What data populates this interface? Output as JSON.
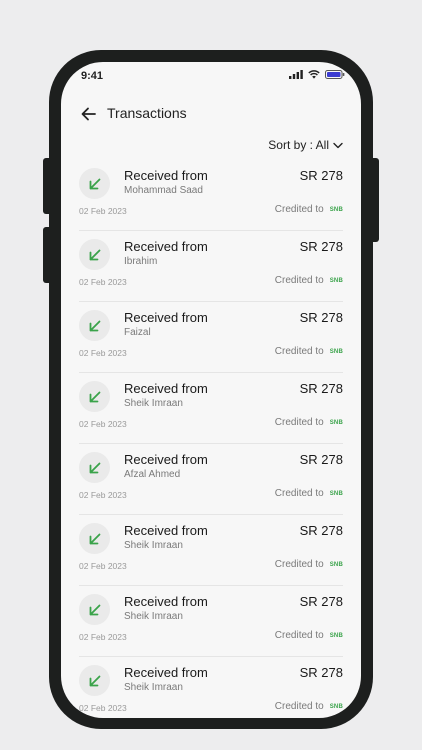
{
  "status": {
    "time": "9:41"
  },
  "header": {
    "title": "Transactions"
  },
  "sort": {
    "label": "Sort by : All"
  },
  "colors": {
    "accent_green": "#3aa34a",
    "icon_bg": "#eaeaea"
  },
  "transactions": [
    {
      "title": "Received from",
      "name": "Mohammad Saad",
      "amount": "SR 278",
      "date": "02 Feb 2023",
      "credited": "Credited to",
      "bank": "SNB"
    },
    {
      "title": "Received from",
      "name": "Ibrahim",
      "amount": "SR 278",
      "date": "02 Feb 2023",
      "credited": "Credited to",
      "bank": "SNB"
    },
    {
      "title": "Received from",
      "name": "Faizal",
      "amount": "SR 278",
      "date": "02 Feb 2023",
      "credited": "Credited to",
      "bank": "SNB"
    },
    {
      "title": "Received from",
      "name": "Sheik Imraan",
      "amount": "SR 278",
      "date": "02 Feb 2023",
      "credited": "Credited to",
      "bank": "SNB"
    },
    {
      "title": "Received from",
      "name": "Afzal Ahmed",
      "amount": "SR 278",
      "date": "02 Feb 2023",
      "credited": "Credited to",
      "bank": "SNB"
    },
    {
      "title": "Received from",
      "name": "Sheik Imraan",
      "amount": "SR 278",
      "date": "02 Feb 2023",
      "credited": "Credited to",
      "bank": "SNB"
    },
    {
      "title": "Received from",
      "name": "Sheik Imraan",
      "amount": "SR 278",
      "date": "02 Feb 2023",
      "credited": "Credited to",
      "bank": "SNB"
    },
    {
      "title": "Received from",
      "name": "Sheik Imraan",
      "amount": "SR 278",
      "date": "02 Feb 2023",
      "credited": "Credited to",
      "bank": "SNB"
    }
  ]
}
